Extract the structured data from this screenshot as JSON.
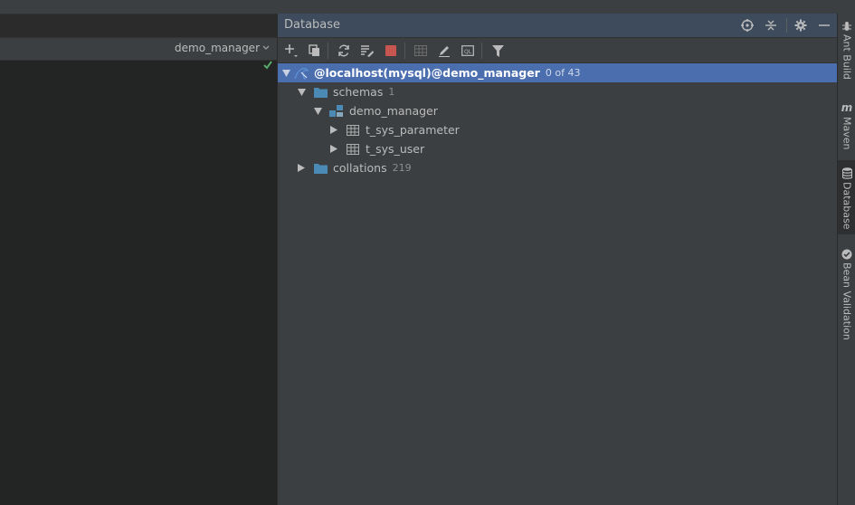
{
  "editor": {
    "db_selector": "demo_manager"
  },
  "panel": {
    "title": "Database"
  },
  "tree": [
    {
      "label": "@localhost(mysql)@demo_manager",
      "count": "0 of 43",
      "kind": "datasource",
      "expanded": true,
      "level": 0,
      "selected": true
    },
    {
      "label": "schemas",
      "count": "1",
      "kind": "folder",
      "expanded": true,
      "level": 1
    },
    {
      "label": "demo_manager",
      "count": "",
      "kind": "schema",
      "expanded": true,
      "level": 2
    },
    {
      "label": "t_sys_parameter",
      "count": "",
      "kind": "table",
      "expanded": false,
      "level": 3
    },
    {
      "label": "t_sys_user",
      "count": "",
      "kind": "table",
      "expanded": false,
      "level": 3
    },
    {
      "label": "collations",
      "count": "219",
      "kind": "folder",
      "expanded": false,
      "level": 1
    }
  ],
  "side_tabs": {
    "ant": "Ant Build",
    "maven": "Maven",
    "database": "Database",
    "bean": "Bean Validation"
  },
  "colors": {
    "selection": "#4b6eaf",
    "folder": "#4a8ab5",
    "stop": "#c75450",
    "check": "#59a869"
  }
}
